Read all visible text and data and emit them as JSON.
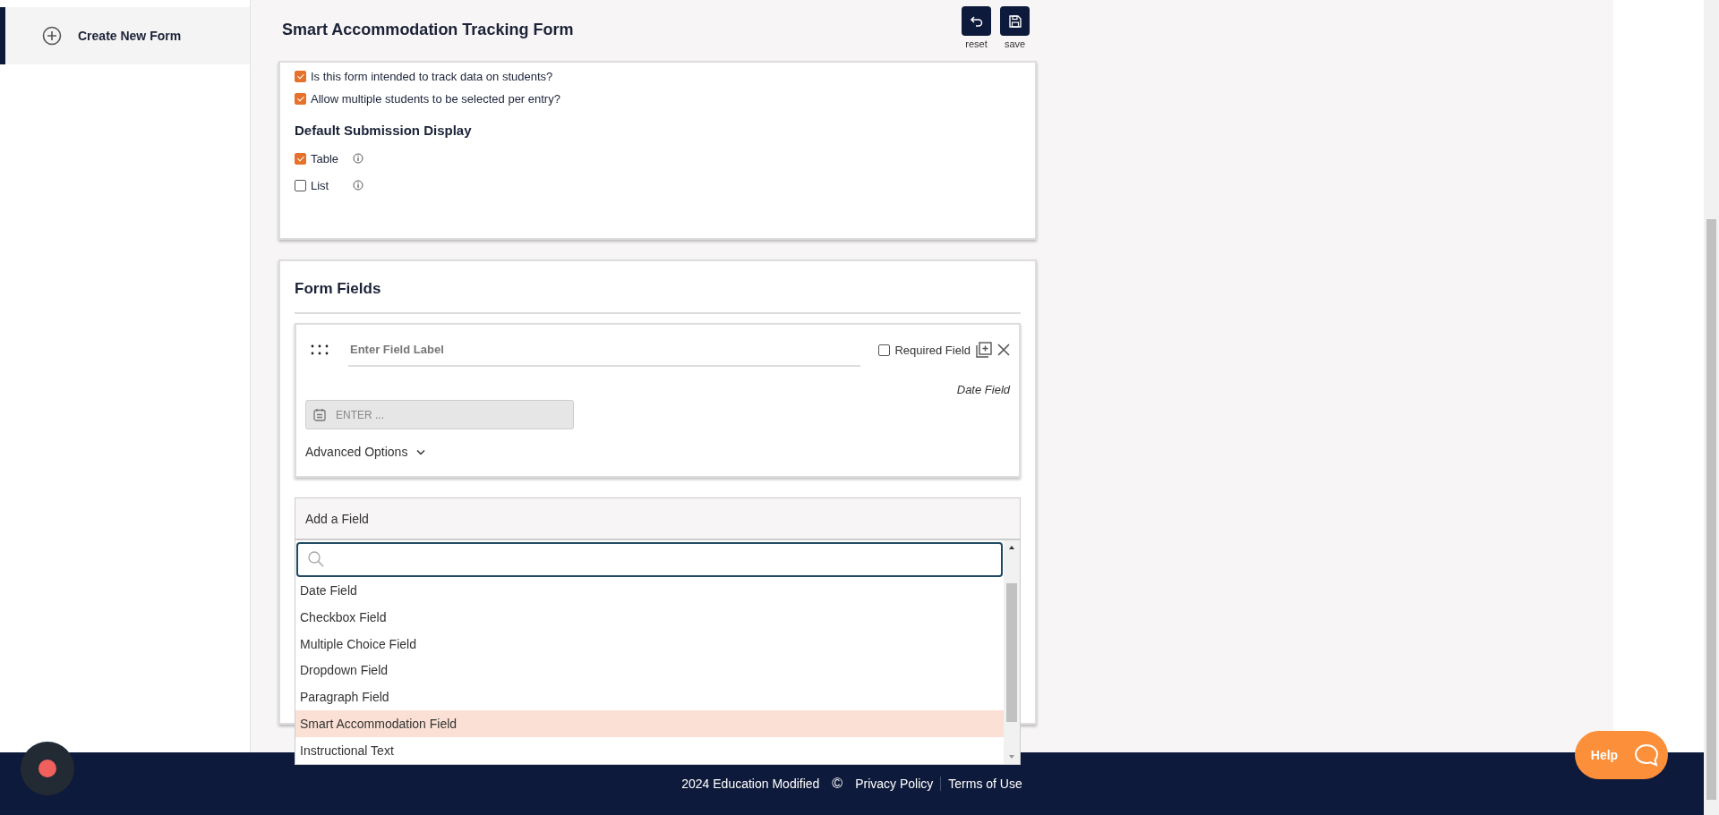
{
  "sidebar": {
    "items": [
      {
        "label": "Create New Form",
        "selected": true
      }
    ]
  },
  "header": {
    "title": "Smart Accommodation Tracking Form",
    "actions": [
      {
        "label": "reset",
        "kind": "undo"
      },
      {
        "label": "save",
        "kind": "save"
      }
    ]
  },
  "settings": {
    "options": [
      {
        "label": "Is this form intended to track data on students?",
        "checked": true
      },
      {
        "label": "Allow multiple students to be selected per entry?",
        "checked": true
      }
    ],
    "display_heading": "Default Submission Display",
    "display_options": [
      {
        "label": "Table",
        "checked": true
      },
      {
        "label": "List",
        "checked": false
      }
    ]
  },
  "form_fields": {
    "title": "Form Fields",
    "fields": [
      {
        "label_placeholder": "Enter Field Label",
        "required_label": "Required Field",
        "required": false,
        "type_label": "Date Field",
        "input_placeholder": "ENTER ...",
        "advanced_label": "Advanced Options",
        "expanded": false
      }
    ]
  },
  "add_field": {
    "label": "Add a Field",
    "options": [
      {
        "label": "Date Field",
        "selected": false
      },
      {
        "label": "Checkbox Field",
        "selected": false
      },
      {
        "label": "Multiple Choice Field",
        "selected": false
      },
      {
        "label": "Dropdown Field",
        "selected": false
      },
      {
        "label": "Paragraph Field",
        "selected": false
      },
      {
        "label": "Smart Accommodation Field",
        "selected": true
      },
      {
        "label": "Instructional Text",
        "selected": false
      }
    ]
  },
  "footer": {
    "copyright": "2024 Education Modified",
    "copyright_symbol": "©",
    "links": [
      "Privacy Policy",
      "Terms of Use"
    ]
  },
  "help": {
    "label": "Help"
  }
}
